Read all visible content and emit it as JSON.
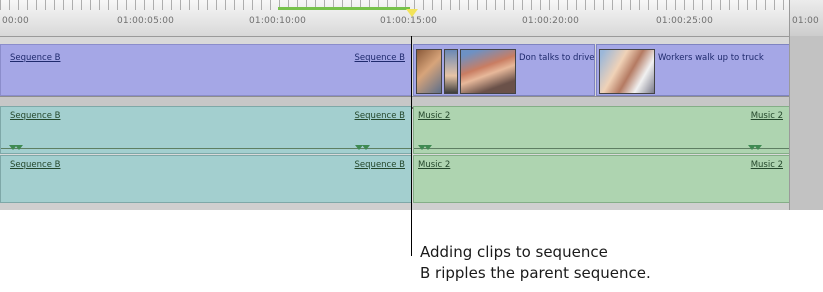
{
  "ruler": {
    "timecodes": [
      "00:00",
      "01:00:05:00",
      "01:00:10:00",
      "01:00:15:00",
      "01:00:20:00",
      "01:00:25:00",
      "01:00"
    ]
  },
  "video_track": {
    "clips": [
      {
        "left_label": "Sequence B",
        "right_label": "Sequence B",
        "color": "#a5a7e6"
      },
      {
        "label": "Don talks to drive",
        "color": "#a5a7e6"
      },
      {
        "label": "Workers walk up to truck",
        "color": "#a5a7e6"
      }
    ]
  },
  "audio_tracks": [
    {
      "seq_left": "Sequence B",
      "seq_right": "Sequence B",
      "music_left": "Music 2",
      "music_right": "Music 2"
    },
    {
      "seq_left": "Sequence B",
      "seq_right": "Sequence B",
      "music_left": "Music 2",
      "music_right": "Music 2"
    }
  ],
  "callout": {
    "line1": "Adding clips to sequence",
    "line2": "B ripples the parent sequence."
  },
  "colors": {
    "video_clip": "#a5a7e6",
    "audio_sequence": "#a3cfcf",
    "audio_music": "#aed4b0",
    "playhead": "#f2e35a",
    "in_out_range": "#76c24b"
  }
}
